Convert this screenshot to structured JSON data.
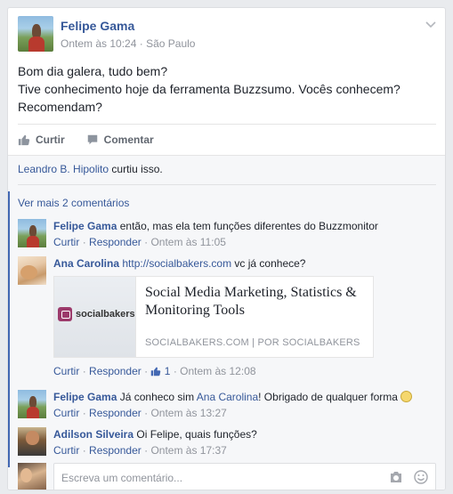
{
  "post": {
    "author": "Felipe Gama",
    "time": "Ontem às 10:24",
    "separator": "·",
    "location": "São Paulo",
    "lines": [
      "Bom dia galera, tudo bem?",
      "Tive conhecimento hoje da ferramenta Buzzsumo. Vocês conhecem?",
      "Recomendam?"
    ]
  },
  "actions": {
    "like": "Curtir",
    "comment": "Comentar"
  },
  "likes": {
    "name": "Leandro B. Hipolito",
    "text": " curtiu isso."
  },
  "more_comments": "Ver mais 2 comentários",
  "comments": [
    {
      "name": "Felipe Gama",
      "text": "então, mas ela tem funções diferentes do Buzzmonitor",
      "like": "Curtir",
      "reply": "Responder",
      "time": "Ontem às 11:05"
    },
    {
      "name": "Ana Carolina",
      "link": "http://socialbakers.com",
      "text": " vc já conhece?",
      "like": "Curtir",
      "reply": "Responder",
      "like_count": "1",
      "time": "Ontem às 12:08"
    },
    {
      "name": "Felipe Gama",
      "text_before": "Já conheco sim ",
      "mention": "Ana Carolina",
      "text_after": "! Obrigado de qualquer forma ",
      "like": "Curtir",
      "reply": "Responder",
      "time": "Ontem às 13:27"
    },
    {
      "name": "Adilson Silveira",
      "text": "Oi Felipe, quais funções?",
      "like": "Curtir",
      "reply": "Responder",
      "time": "Ontem às 17:37"
    }
  ],
  "share": {
    "logo_text": "socialbakers",
    "title": "Social Media Marketing, Statistics & Monitoring Tools",
    "domain": "SOCIALBAKERS.COM",
    "by": "POR SOCIALBAKERS",
    "sep": "|"
  },
  "composer": {
    "placeholder": "Escreva um comentário..."
  },
  "dot": "·"
}
